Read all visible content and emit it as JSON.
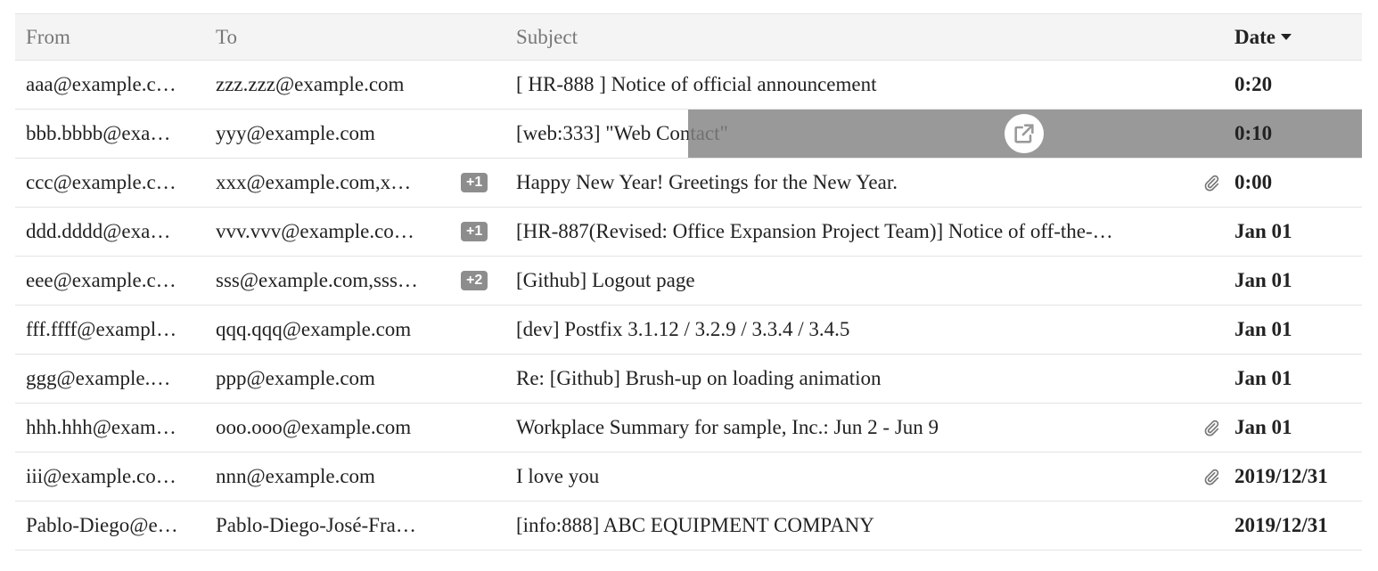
{
  "header": {
    "from": "From",
    "to": "To",
    "subject": "Subject",
    "date": "Date"
  },
  "rows": [
    {
      "from": "aaa@example.c…",
      "to": "zzz.zzz@example.com",
      "more": "",
      "subject": "[ HR-888 ] Notice of official announcement",
      "attachment": false,
      "date": "0:20"
    },
    {
      "from": "bbb.bbbb@exa…",
      "to": "yyy@example.com",
      "more": "",
      "subject": "[web:333] \"Web Contact\"",
      "attachment": false,
      "date": "0:10"
    },
    {
      "from": "ccc@example.c…",
      "to": "xxx@example.com,x…",
      "more": "+1",
      "subject": "Happy New Year! Greetings for the New Year.",
      "attachment": true,
      "date": "0:00"
    },
    {
      "from": "ddd.dddd@exa…",
      "to": "vvv.vvv@example.co…",
      "more": "+1",
      "subject": "[HR-887(Revised: Office Expansion Project Team)] Notice of off-the-…",
      "attachment": false,
      "date": "Jan 01"
    },
    {
      "from": "eee@example.c…",
      "to": "sss@example.com,sss…",
      "more": "+2",
      "subject": "[Github] Logout page",
      "attachment": false,
      "date": "Jan 01"
    },
    {
      "from": "fff.ffff@exampl…",
      "to": "qqq.qqq@example.com",
      "more": "",
      "subject": "[dev] Postfix 3.1.12 / 3.2.9 / 3.3.4 / 3.4.5",
      "attachment": false,
      "date": "Jan 01"
    },
    {
      "from": "ggg@example.…",
      "to": "ppp@example.com",
      "more": "",
      "subject": "Re: [Github] Brush-up on loading animation",
      "attachment": false,
      "date": "Jan 01"
    },
    {
      "from": "hhh.hhh@exam…",
      "to": "ooo.ooo@example.com",
      "more": "",
      "subject": "Workplace Summary for sample, Inc.: Jun 2 - Jun 9",
      "attachment": true,
      "date": "Jan 01"
    },
    {
      "from": "iii@example.co…",
      "to": "nnn@example.com",
      "more": "",
      "subject": "I love you",
      "attachment": true,
      "date": "2019/12/31"
    },
    {
      "from": "Pablo-Diego@e…",
      "to": "Pablo-Diego-José-Fra…",
      "more": "",
      "subject": "[info:888] ABC EQUIPMENT COMPANY",
      "attachment": false,
      "date": "2019/12/31"
    }
  ],
  "hover_row_index": 1,
  "icons": {
    "sort": "caret-down-icon",
    "attachment": "paperclip-icon",
    "open": "open-in-new-icon"
  },
  "colors": {
    "header_bg": "#f4f4f4",
    "overlay": "#8a8a8a",
    "badge": "#8d8d8d"
  }
}
